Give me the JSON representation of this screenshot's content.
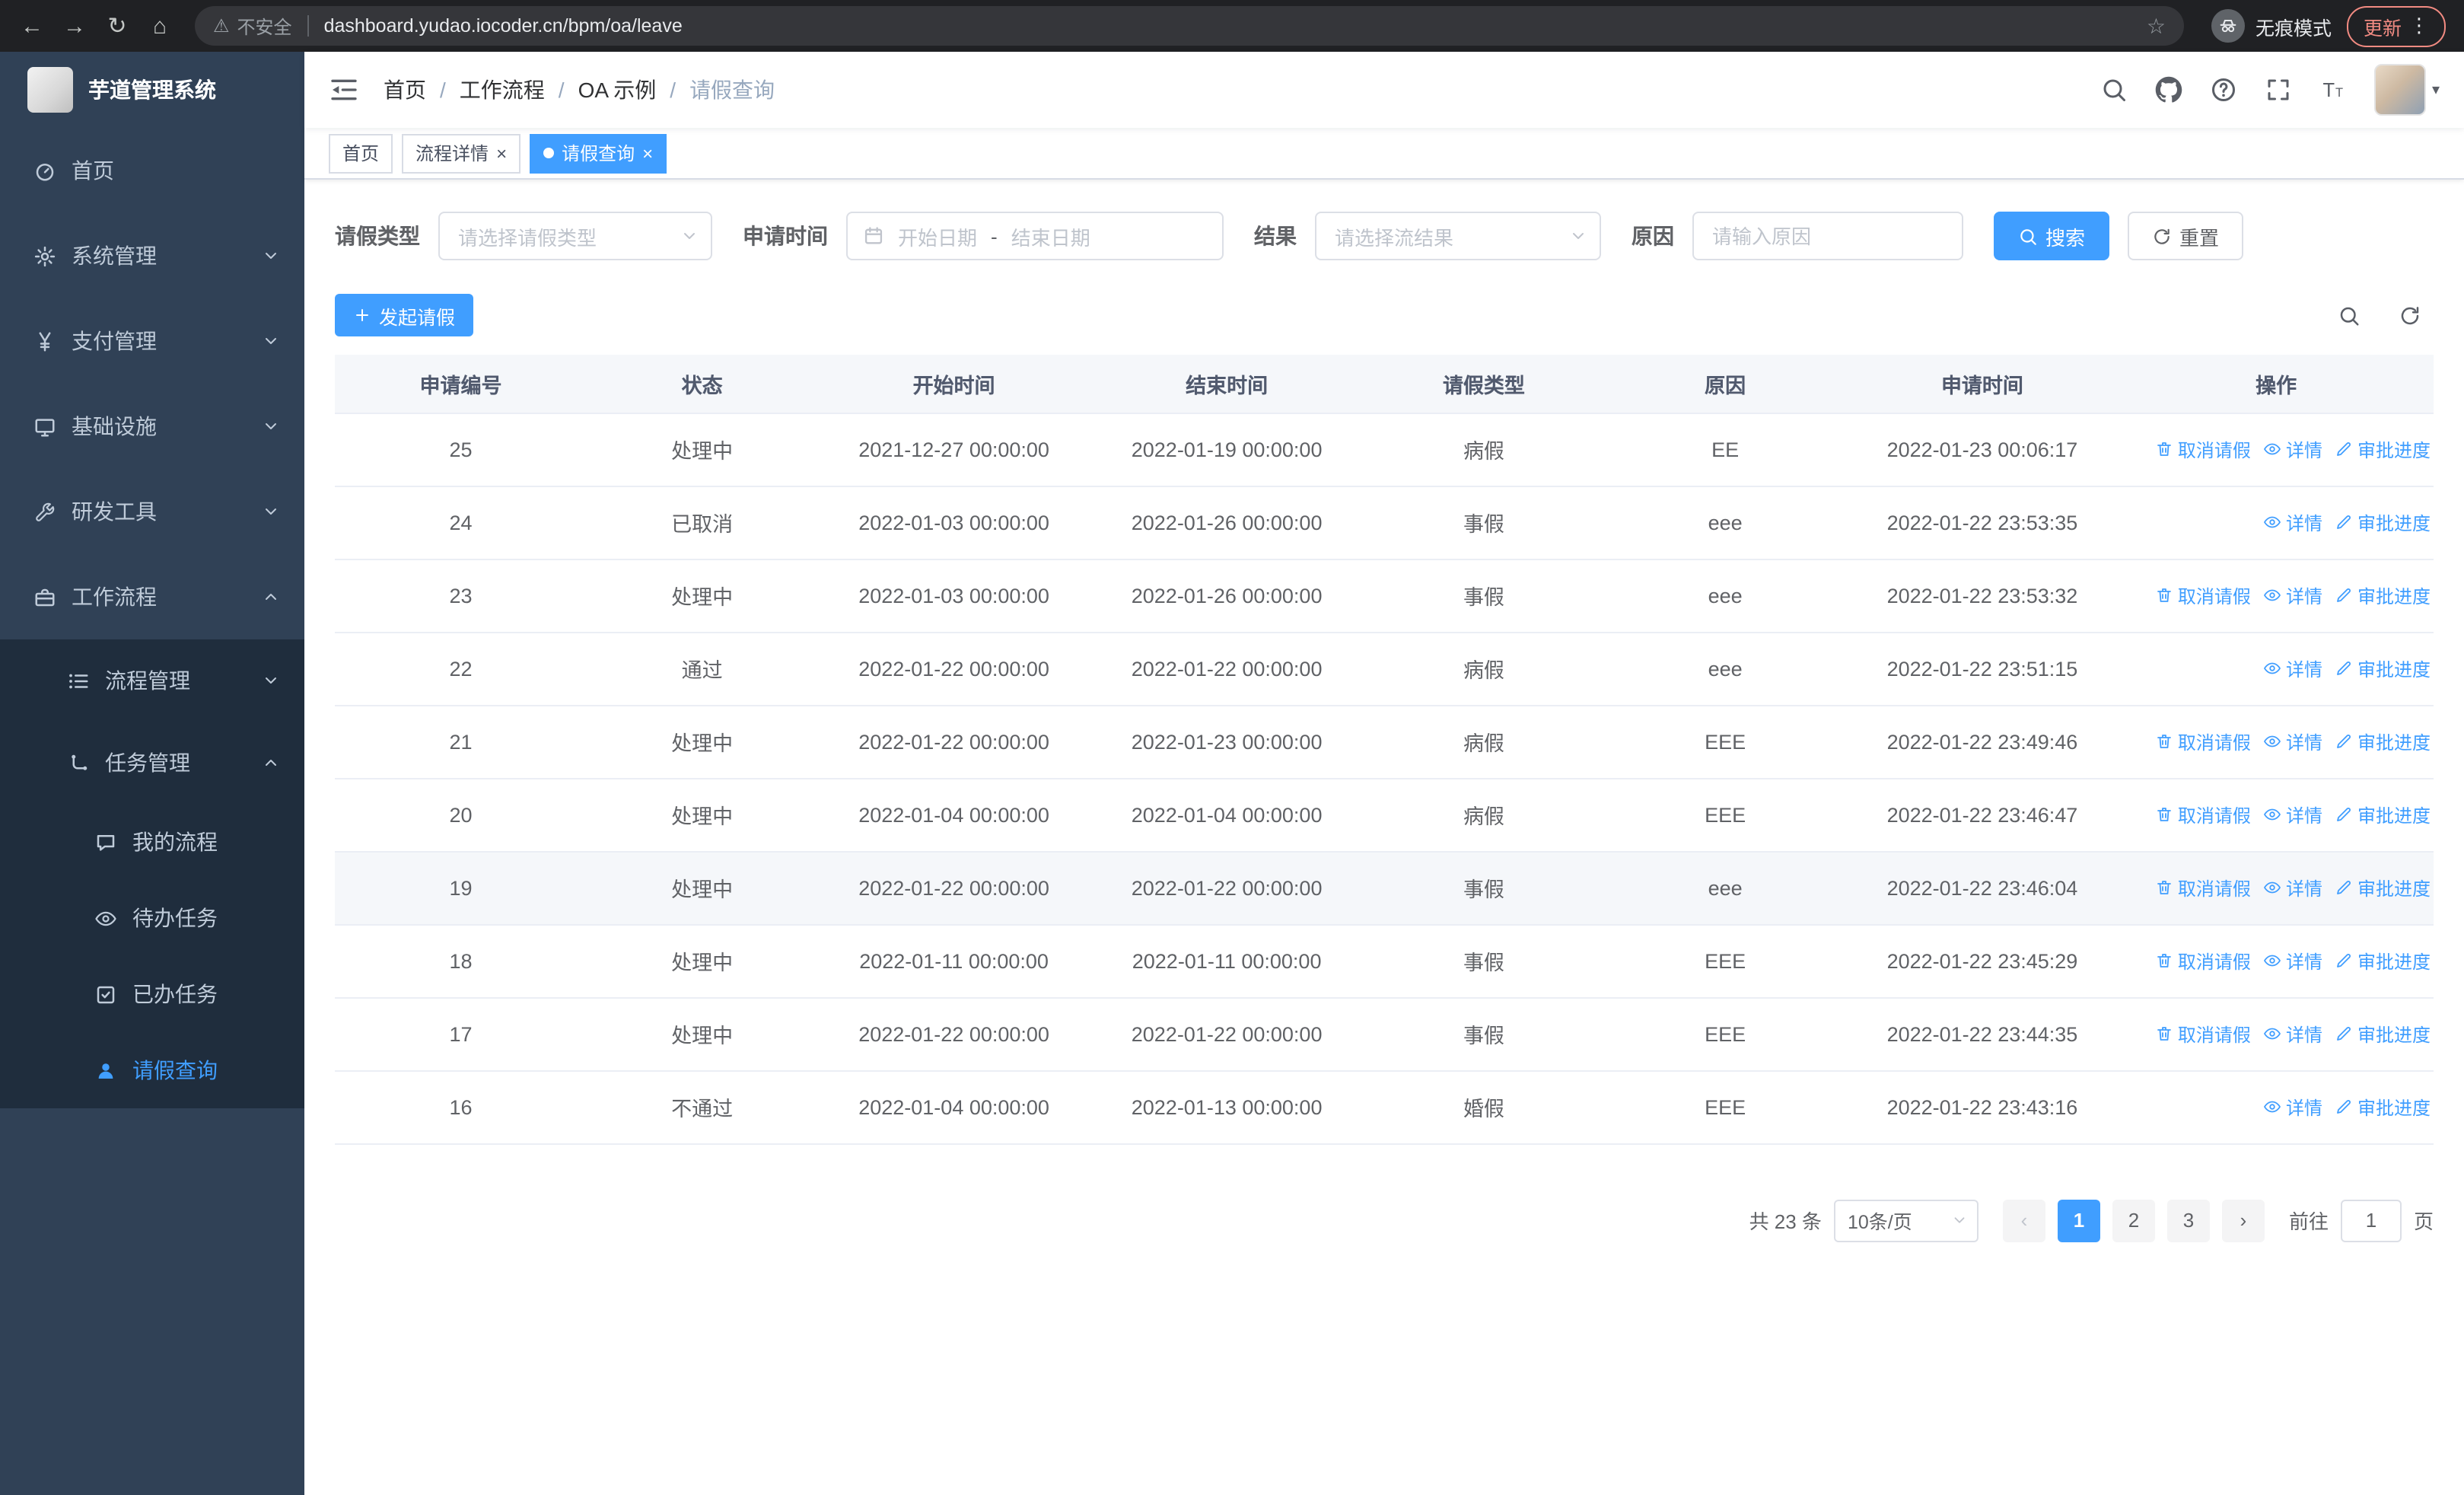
{
  "browser": {
    "security_chip": "不安全",
    "url": "dashboard.yudao.iocoder.cn/bpm/oa/leave",
    "incognito_label": "无痕模式",
    "update_label": "更新"
  },
  "icons": {
    "back": "←",
    "forward": "→",
    "reload": "↻",
    "home": "⌂",
    "warning": "⚠",
    "star": "☆",
    "more": "⋮",
    "caret_down": "▾",
    "prev": "‹",
    "next": "›"
  },
  "sidebar": {
    "app_title": "芋道管理系统",
    "items": [
      {
        "label": "首页"
      },
      {
        "label": "系统管理"
      },
      {
        "label": "支付管理"
      },
      {
        "label": "基础设施"
      },
      {
        "label": "研发工具"
      },
      {
        "label": "工作流程"
      }
    ],
    "workflow_submenu": {
      "process_mgmt": "流程管理",
      "task_mgmt": "任务管理",
      "task_children": [
        {
          "label": "我的流程"
        },
        {
          "label": "待办任务"
        },
        {
          "label": "已办任务"
        },
        {
          "label": "请假查询"
        }
      ]
    }
  },
  "breadcrumb": [
    "首页",
    "工作流程",
    "OA 示例",
    "请假查询"
  ],
  "tabs": [
    {
      "label": "首页"
    },
    {
      "label": "流程详情"
    },
    {
      "label": "请假查询"
    }
  ],
  "filters": {
    "type_label": "请假类型",
    "type_placeholder": "请选择请假类型",
    "time_label": "申请时间",
    "start_placeholder": "开始日期",
    "range_separator": "-",
    "end_placeholder": "结束日期",
    "result_label": "结果",
    "result_placeholder": "请选择流结果",
    "reason_label": "原因",
    "reason_placeholder": "请输入原因",
    "search_button": "搜索",
    "reset_button": "重置"
  },
  "toolbar": {
    "create_button": "发起请假"
  },
  "table": {
    "columns": [
      "申请编号",
      "状态",
      "开始时间",
      "结束时间",
      "请假类型",
      "原因",
      "申请时间",
      "操作"
    ],
    "action_labels": {
      "cancel": "取消请假",
      "detail": "详情",
      "progress": "审批进度"
    },
    "rows": [
      {
        "id": "25",
        "status": "处理中",
        "start": "2021-12-27 00:00:00",
        "end": "2022-01-19 00:00:00",
        "type": "病假",
        "reason": "EE",
        "applied": "2022-01-23 00:06:17"
      },
      {
        "id": "24",
        "status": "已取消",
        "start": "2022-01-03 00:00:00",
        "end": "2022-01-26 00:00:00",
        "type": "事假",
        "reason": "eee",
        "applied": "2022-01-22 23:53:35"
      },
      {
        "id": "23",
        "status": "处理中",
        "start": "2022-01-03 00:00:00",
        "end": "2022-01-26 00:00:00",
        "type": "事假",
        "reason": "eee",
        "applied": "2022-01-22 23:53:32"
      },
      {
        "id": "22",
        "status": "通过",
        "start": "2022-01-22 00:00:00",
        "end": "2022-01-22 00:00:00",
        "type": "病假",
        "reason": "eee",
        "applied": "2022-01-22 23:51:15"
      },
      {
        "id": "21",
        "status": "处理中",
        "start": "2022-01-22 00:00:00",
        "end": "2022-01-23 00:00:00",
        "type": "病假",
        "reason": "EEE",
        "applied": "2022-01-22 23:49:46"
      },
      {
        "id": "20",
        "status": "处理中",
        "start": "2022-01-04 00:00:00",
        "end": "2022-01-04 00:00:00",
        "type": "病假",
        "reason": "EEE",
        "applied": "2022-01-22 23:46:47"
      },
      {
        "id": "19",
        "status": "处理中",
        "start": "2022-01-22 00:00:00",
        "end": "2022-01-22 00:00:00",
        "type": "事假",
        "reason": "eee",
        "applied": "2022-01-22 23:46:04"
      },
      {
        "id": "18",
        "status": "处理中",
        "start": "2022-01-11 00:00:00",
        "end": "2022-01-11 00:00:00",
        "type": "事假",
        "reason": "EEE",
        "applied": "2022-01-22 23:45:29"
      },
      {
        "id": "17",
        "status": "处理中",
        "start": "2022-01-22 00:00:00",
        "end": "2022-01-22 00:00:00",
        "type": "事假",
        "reason": "EEE",
        "applied": "2022-01-22 23:44:35"
      },
      {
        "id": "16",
        "status": "不通过",
        "start": "2022-01-04 00:00:00",
        "end": "2022-01-13 00:00:00",
        "type": "婚假",
        "reason": "EEE",
        "applied": "2022-01-22 23:43:16"
      }
    ]
  },
  "pagination": {
    "total": "共 23 条",
    "page_size": "10条/页",
    "pages": [
      "1",
      "2",
      "3"
    ],
    "goto_label": "前往",
    "goto_value": "1",
    "goto_suffix": "页"
  },
  "colors": {
    "accent": "#409eff",
    "sidebar_bg": "#304156",
    "submenu_bg": "#1f2d3d",
    "chrome_bg": "#202124",
    "table_header_bg": "#f5f7fa"
  }
}
